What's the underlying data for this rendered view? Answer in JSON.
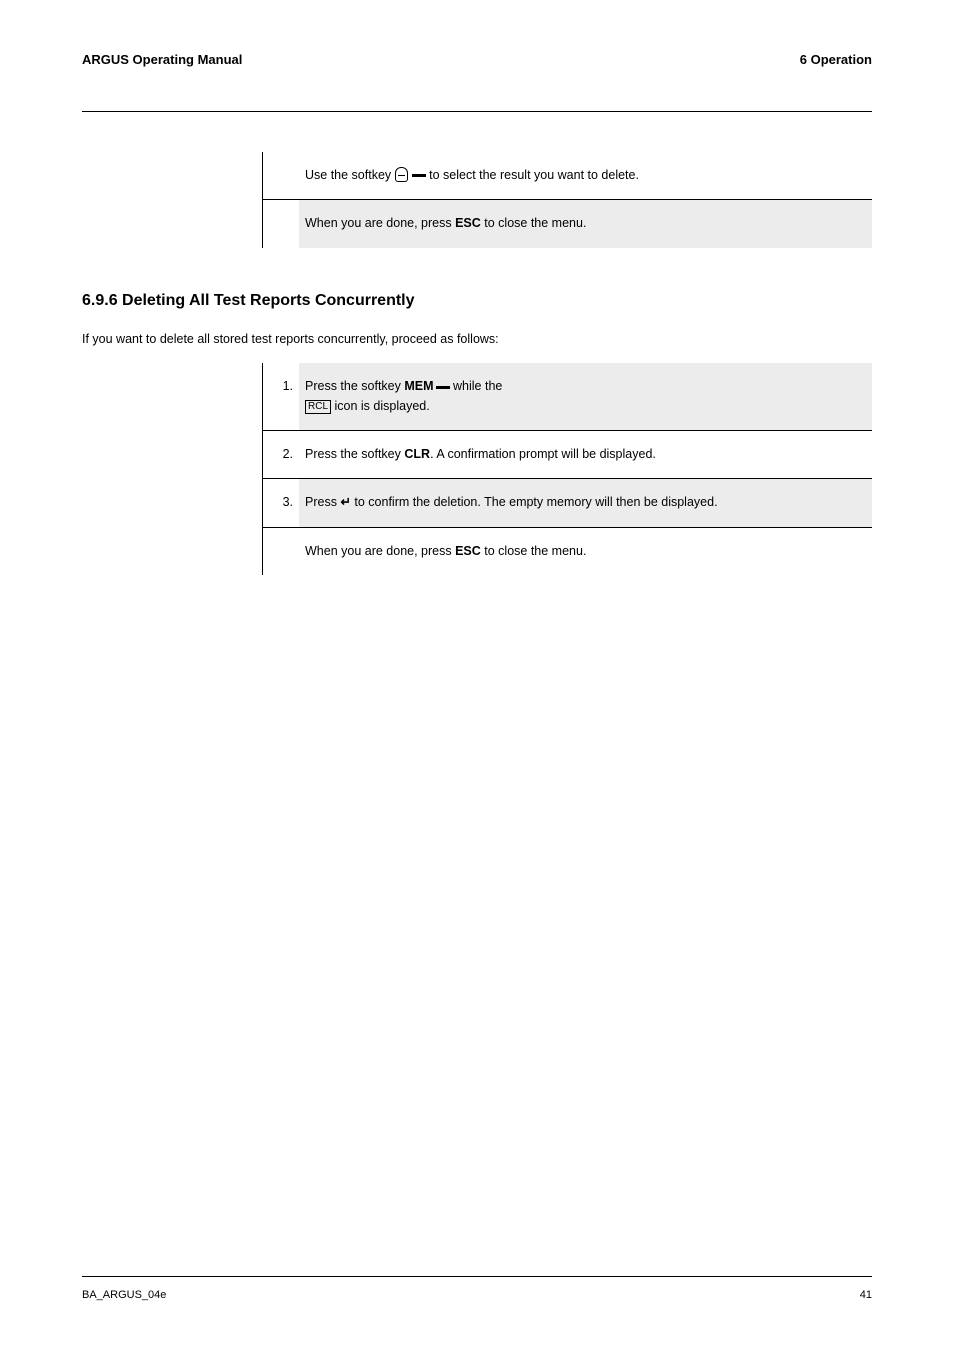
{
  "header": {
    "left": "ARGUS Operating Manual",
    "right": "6 Operation"
  },
  "section1": {
    "steps": [
      {
        "num": "",
        "text_before": "Use the softkey ",
        "text_after": " to select the result you want to delete.",
        "has_level_icon": true
      },
      {
        "num": "",
        "text": "When you are done, press ESC to close the menu."
      }
    ]
  },
  "section2": {
    "heading": "6.9.6   Deleting All Test Reports Concurrently",
    "intro": "If you want to delete all stored test reports concurrently, proceed as follows:",
    "steps": [
      {
        "num": "1.",
        "text_before": "Press the softkey ",
        "key": "MEM",
        "text_after": " while the ",
        "has_rcl": true,
        "text_end": " icon is displayed."
      },
      {
        "num": "2.",
        "text_before": "Press the softkey ",
        "key": "CLR",
        "text_after": ". A confirmation prompt will be displayed."
      },
      {
        "num": "3.",
        "text_before": "Press ",
        "key": "↵",
        "text_after": " to confirm the deletion. The empty memory will then be displayed."
      },
      {
        "num": "",
        "text": "When you are done, press ESC to close the menu."
      }
    ]
  },
  "footer": {
    "left": "BA_ARGUS_04e",
    "right": "41"
  }
}
